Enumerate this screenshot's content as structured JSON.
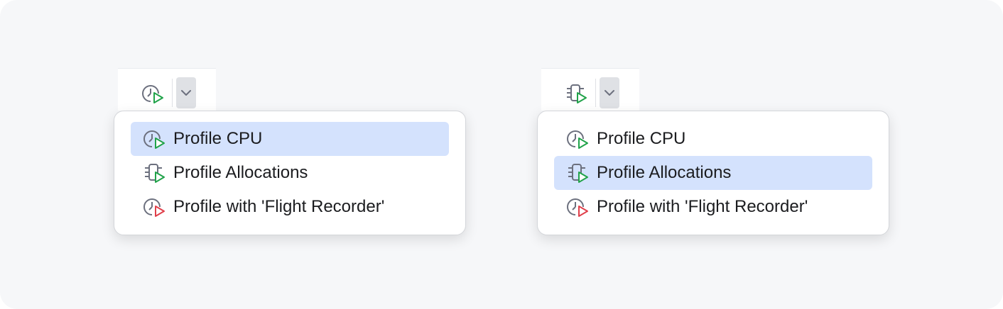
{
  "colors": {
    "background": "#f6f7f9",
    "selection": "#d4e2fd",
    "run_green": "#21a34a",
    "run_red": "#e0404b",
    "icon_gray": "#6c707e"
  },
  "demos": [
    {
      "toolbar": {
        "icon": "cpu-profile-icon",
        "dropdown_icon": "chevron-down-icon"
      },
      "menu": {
        "selected_index": 0,
        "items": [
          {
            "label": "Profile CPU",
            "icon": "cpu-profile-icon"
          },
          {
            "label": "Profile Allocations",
            "icon": "allocations-profile-icon"
          },
          {
            "label": "Profile with 'Flight Recorder'",
            "icon": "flight-recorder-icon"
          }
        ]
      }
    },
    {
      "toolbar": {
        "icon": "allocations-profile-icon",
        "dropdown_icon": "chevron-down-icon"
      },
      "menu": {
        "selected_index": 1,
        "items": [
          {
            "label": "Profile CPU",
            "icon": "cpu-profile-icon"
          },
          {
            "label": "Profile Allocations",
            "icon": "allocations-profile-icon"
          },
          {
            "label": "Profile with 'Flight Recorder'",
            "icon": "flight-recorder-icon"
          }
        ]
      }
    }
  ]
}
